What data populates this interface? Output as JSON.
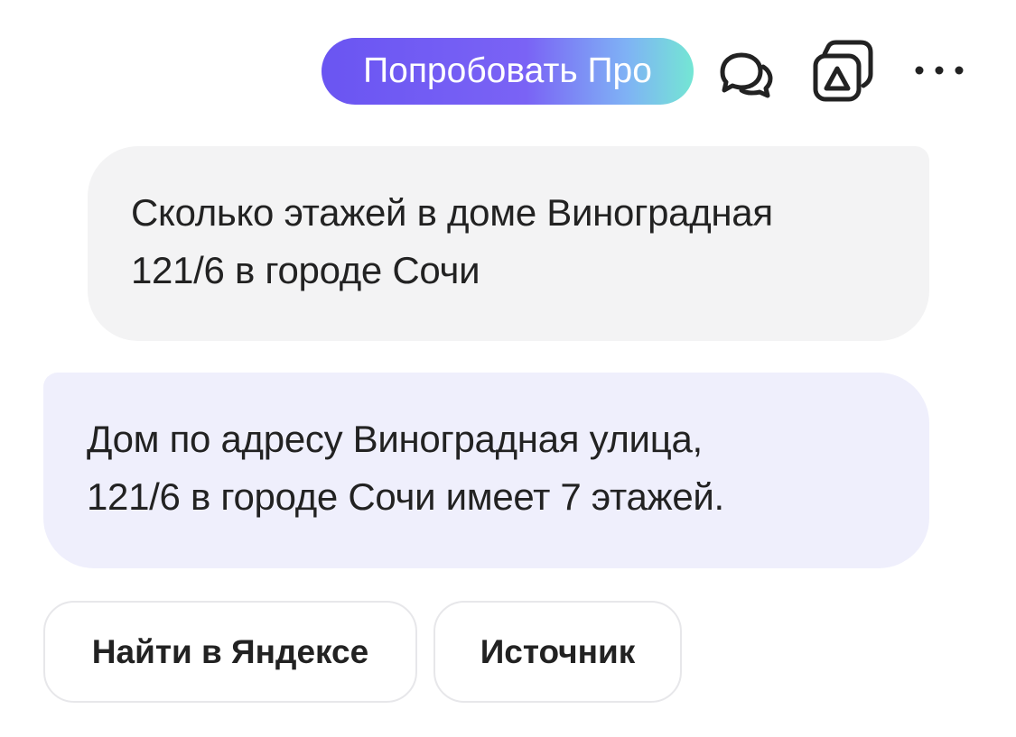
{
  "header": {
    "pro_button_label": "Попробовать Про",
    "icons": [
      "chat-bubbles-icon",
      "share-icon",
      "more-icon"
    ],
    "pro_gradient": [
      "#6a55f2",
      "#74e6d4"
    ]
  },
  "conversation": {
    "user_message": {
      "lines": [
        "Сколько этажей в доме Виноградная",
        "121/6 в городе Сочи"
      ],
      "background": "#f3f3f4"
    },
    "assistant_message": {
      "lines": [
        "Дом по адресу Виноградная улица,",
        "121/6 в городе Сочи имеет 7 этажей."
      ],
      "background": "#efeffc"
    }
  },
  "actions": {
    "search_label": "Найти в Яндексе",
    "source_label": "Источник"
  }
}
